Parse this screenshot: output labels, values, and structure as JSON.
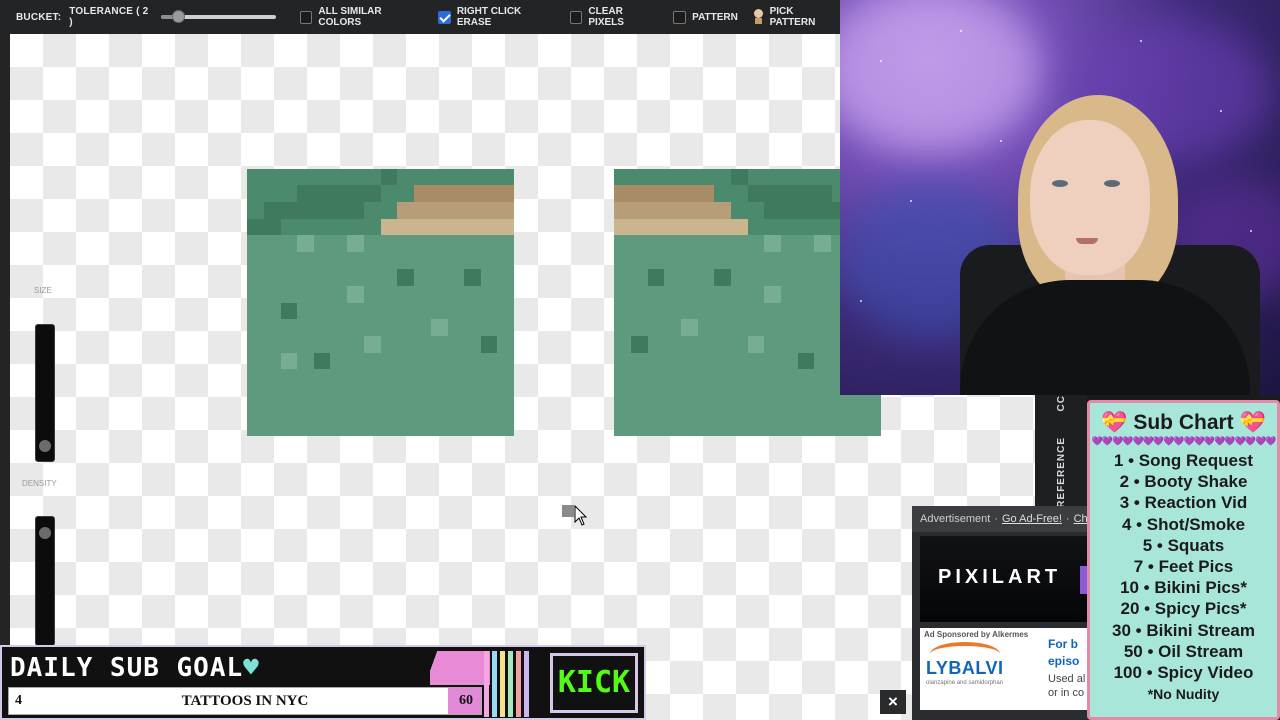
{
  "toolbar": {
    "bucket_label": "BUCKET:",
    "tolerance_label": "TOLERANCE ( 2 )",
    "tolerance_value": 0.15,
    "all_similar_colors": {
      "label": "ALL SIMILAR COLORS",
      "checked": false
    },
    "right_click_erase": {
      "label": "RIGHT CLICK ERASE",
      "checked": true
    },
    "clear_pixels": {
      "label": "CLEAR PIXELS",
      "checked": false
    },
    "pattern": {
      "label": "PATTERN",
      "checked": false
    },
    "pick_pattern_label": "PICK PATTERN"
  },
  "left_panel": {
    "size_label": "SIZE",
    "density_label": "DENSITY"
  },
  "reference_panel": {
    "cc_label": "CC",
    "reference_label": "REFERENCE"
  },
  "ad": {
    "advertisement_label": "Advertisement",
    "separator": "·",
    "go_ad_free_link": "Go Ad-Free!",
    "separator2": "·",
    "chat_link": "Cha",
    "banner_text": "PIXILART",
    "sponsored_label": "Ad Sponsored by Alkermes",
    "lybalvi_brand": "LYBALVI",
    "lybalvi_fine": "olanzapine and samidorphan",
    "lybalvi_right_line1": "For b",
    "lybalvi_right_line2": "episo",
    "lybalvi_right_line3": "Used al",
    "lybalvi_right_line4": "or in co",
    "close_label": "×"
  },
  "sub_chart": {
    "title": "💝 Sub Chart 💝",
    "hearts": "💜💜💜💜💜💜💜💜💜💜💜💜💜💜💜💜💜💜",
    "items": [
      "1 • Song Request",
      "2 • Booty Shake",
      "3 • Reaction Vid",
      "4 • Shot/Smoke",
      "5 • Squats",
      "7 • Feet Pics",
      "10 • Bikini Pics*",
      "20 • Spicy Pics*",
      "30 • Bikini Stream",
      "50 • Oil Stream",
      "100 • Spicy Video"
    ],
    "note": "*No Nudity"
  },
  "goal": {
    "title": "DAILY SUB GOAL",
    "heart": "♥",
    "current": "4",
    "name": "TATTOOS IN NYC",
    "target": "60",
    "progress": 0.067,
    "kick_label": "KICK",
    "stripe_colors": [
      "#f3a6e0",
      "#9ad9f0",
      "#f7e08a",
      "#a8e6c0",
      "#f0a0a0",
      "#c9b6f0"
    ]
  },
  "colors": {
    "tile_base": "#5e9a7e",
    "tile_dark": "#3f7a5f",
    "tile_light": "#77ad93",
    "sand": "#cbb58f",
    "kick_green": "#53fc18",
    "goal_pink": "#e28ad8"
  },
  "icons": {
    "pick_pattern": "pick-pattern-icon",
    "cursor": "arrow-cursor-icon",
    "close": "close-icon"
  }
}
